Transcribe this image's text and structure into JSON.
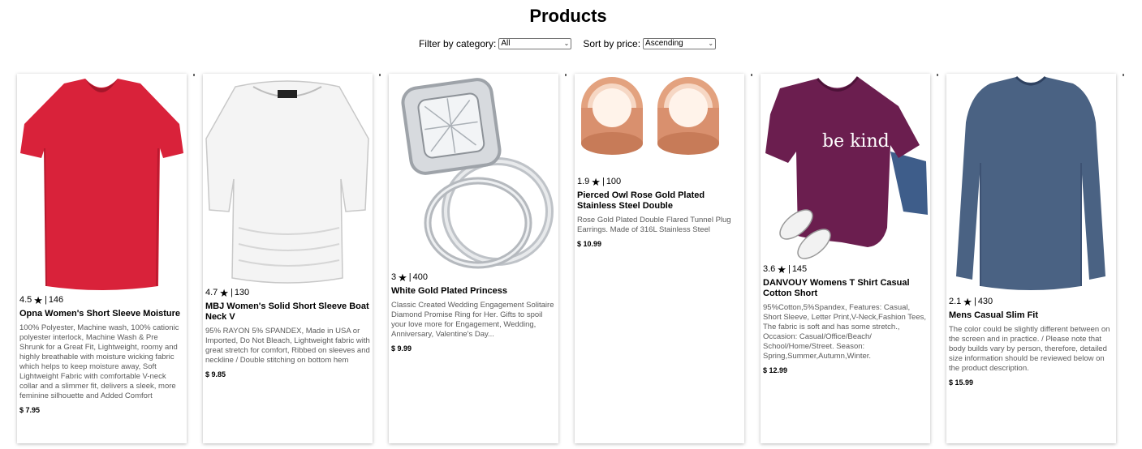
{
  "page": {
    "title": "Products"
  },
  "filters": {
    "category_label": "Filter by category:",
    "category_value": "All",
    "sort_label": "Sort by price:",
    "sort_value": "Ascending"
  },
  "products": [
    {
      "rating": "4.5",
      "count": "146",
      "title": "Opna Women's Short Sleeve Moisture",
      "description": "100% Polyester, Machine wash, 100% cationic polyester interlock, Machine Wash & Pre Shrunk for a Great Fit, Lightweight, roomy and highly breathable with moisture wicking fabric which helps to keep moisture away, Soft Lightweight Fabric with comfortable V-neck collar and a slimmer fit, delivers a sleek, more feminine silhouette and Added Comfort",
      "price": "$ 7.95",
      "image_icon": "red-vneck-tshirt-image"
    },
    {
      "rating": "4.7",
      "count": "130",
      "title": "MBJ Women's Solid Short Sleeve Boat Neck V",
      "description": "95% RAYON 5% SPANDEX, Made in USA or Imported, Do Not Bleach, Lightweight fabric with great stretch for comfort, Ribbed on sleeves and neckline / Double stitching on bottom hem",
      "price": "$ 9.85",
      "image_icon": "white-boat-neck-top-image"
    },
    {
      "rating": "3",
      "count": "400",
      "title": "White Gold Plated Princess",
      "description": "Classic Created Wedding Engagement Solitaire Diamond Promise Ring for Her. Gifts to spoil your love more for Engagement, Wedding, Anniversary, Valentine's Day...",
      "price": "$ 9.99",
      "image_icon": "diamond-ring-image"
    },
    {
      "rating": "1.9",
      "count": "100",
      "title": "Pierced Owl Rose Gold Plated Stainless Steel Double",
      "description": "Rose Gold Plated Double Flared Tunnel Plug Earrings. Made of 316L Stainless Steel",
      "price": "$ 10.99",
      "image_icon": "rose-gold-tunnel-plugs-image"
    },
    {
      "rating": "3.6",
      "count": "145",
      "title": "DANVOUY Womens T Shirt Casual Cotton Short",
      "description": "95%Cotton,5%Spandex, Features: Casual, Short Sleeve, Letter Print,V-Neck,Fashion Tees, The fabric is soft and has some stretch., Occasion: Casual/Office/Beach/ School/Home/Street. Season: Spring,Summer,Autumn,Winter.",
      "price": "$ 12.99",
      "image_icon": "be-kind-purple-tshirt-image",
      "print_text": "be kind"
    },
    {
      "rating": "2.1",
      "count": "430",
      "title": "Mens Casual Slim Fit",
      "description": "The color could be slightly different between on the screen and in practice. / Please note that body builds vary by person, therefore, detailed size information should be reviewed below on the product description.",
      "price": "$ 15.99",
      "image_icon": "blue-long-sleeve-shirt-image"
    }
  ],
  "colors": {
    "red_shirt": "#d9223a",
    "purple_shirt": "#6b1e4f",
    "blue_shirt": "#4a6283",
    "rose_gold": "#d9906e",
    "description_text": "#5a5a5a"
  }
}
